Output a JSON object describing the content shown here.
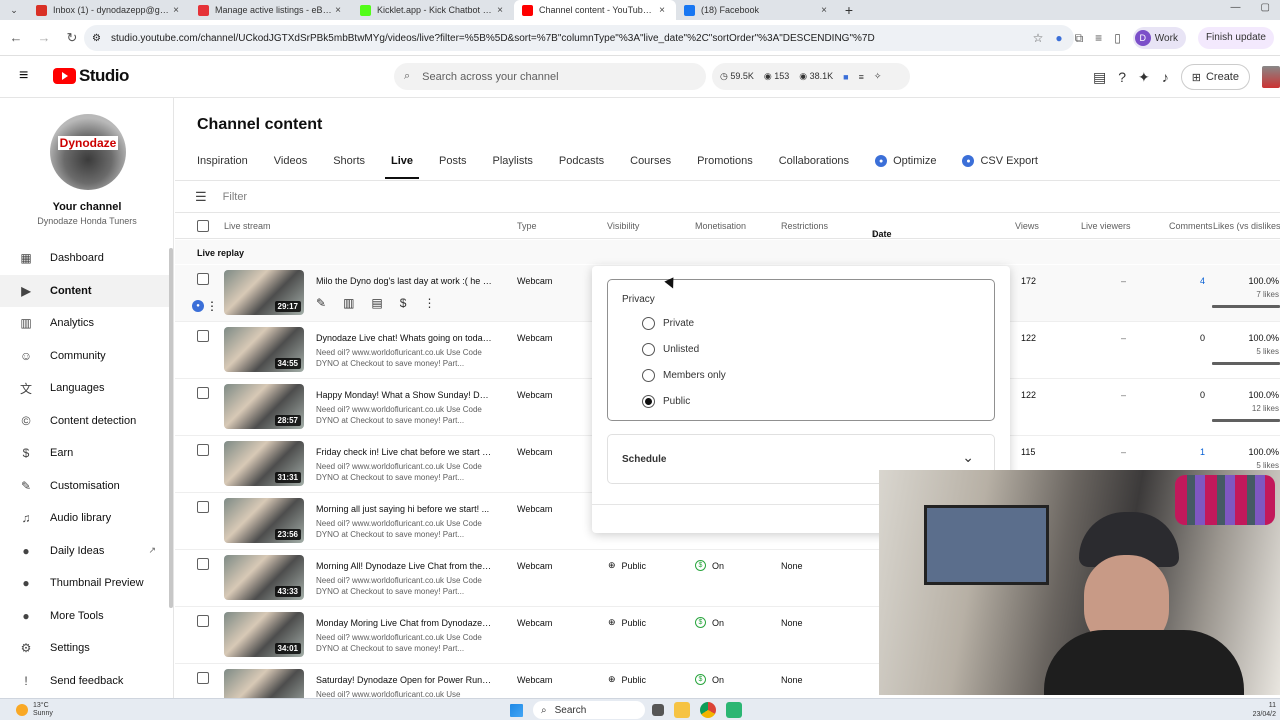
{
  "browser": {
    "tabs": [
      {
        "title": "Inbox (1) - dynodazepp@gmail.com",
        "color": "#d93025",
        "active": false
      },
      {
        "title": "Manage active listings - eBay Seller Hub",
        "color": "#e53238",
        "active": false
      },
      {
        "title": "Kicklet.app - Kick Chatbot and more",
        "color": "#53fc18",
        "active": false
      },
      {
        "title": "Channel content - YouTube Studio",
        "color": "#ff0000",
        "active": true
      },
      {
        "title": "(18) Facebook",
        "color": "#1877f2",
        "active": false
      }
    ],
    "url": "studio.youtube.com/channel/UCkodJGTXdSrPBk5mbBtwMYg/videos/live?filter=%5B%5D&sort=%7B\"columnType\"%3A\"live_date\"%2C\"sortOrder\"%3A\"DESCENDING\"%7D",
    "profile_label": "Work",
    "profile_initial": "D",
    "update_label": "Finish update"
  },
  "header": {
    "logo_text": "Studio",
    "search_placeholder": "Search across your channel",
    "stats": {
      "views": "59.5K",
      "watch": "153",
      "subs": "38.1K"
    },
    "create_label": "Create"
  },
  "sidebar": {
    "channel_label": "Your channel",
    "channel_name": "Dynodaze Honda Tuners",
    "avatar_text": "Dynodaze",
    "items": [
      {
        "label": "Dashboard",
        "icon": "dashboard-icon",
        "glyph": "▦"
      },
      {
        "label": "Content",
        "icon": "content-icon",
        "glyph": "▶",
        "active": true
      },
      {
        "label": "Analytics",
        "icon": "analytics-icon",
        "glyph": "▥"
      },
      {
        "label": "Community",
        "icon": "community-icon",
        "glyph": "☺"
      },
      {
        "label": "Languages",
        "icon": "languages-icon",
        "glyph": "文"
      },
      {
        "label": "Content detection",
        "icon": "copyright-icon",
        "glyph": "©"
      },
      {
        "label": "Earn",
        "icon": "earn-icon",
        "glyph": "$"
      },
      {
        "label": "Customisation",
        "icon": "customisation-icon",
        "glyph": "✎"
      },
      {
        "label": "Audio library",
        "icon": "audio-library-icon",
        "glyph": "♫"
      },
      {
        "label": "Daily Ideas",
        "icon": "daily-ideas-icon",
        "glyph": "●",
        "external": true
      },
      {
        "label": "Thumbnail Preview",
        "icon": "thumbnail-preview-icon",
        "glyph": "●"
      },
      {
        "label": "More Tools",
        "icon": "more-tools-icon",
        "glyph": "●"
      },
      {
        "label": "Settings",
        "icon": "settings-icon",
        "glyph": "⚙"
      },
      {
        "label": "Send feedback",
        "icon": "feedback-icon",
        "glyph": "!"
      }
    ]
  },
  "main": {
    "title": "Channel content",
    "tabs": [
      {
        "label": "Inspiration"
      },
      {
        "label": "Videos"
      },
      {
        "label": "Shorts"
      },
      {
        "label": "Live",
        "active": true
      },
      {
        "label": "Posts"
      },
      {
        "label": "Playlists"
      },
      {
        "label": "Podcasts"
      },
      {
        "label": "Courses"
      },
      {
        "label": "Promotions"
      },
      {
        "label": "Collaborations"
      },
      {
        "label": "Optimize",
        "badge": true
      },
      {
        "label": "CSV Export",
        "badge": true
      }
    ],
    "filter_placeholder": "Filter",
    "columns": {
      "live_stream": "Live stream",
      "type": "Type",
      "visibility": "Visibility",
      "monetisation": "Monetisation",
      "restrictions": "Restrictions",
      "date": "Date",
      "views": "Views",
      "live_viewers": "Live viewers",
      "comments": "Comments",
      "likes": "Likes (vs dislikes)"
    },
    "section_label": "Live replay",
    "rows": [
      {
        "title": "Milo the Dyno dog's last day at work :( he w...",
        "desc": "",
        "duration": "29:17",
        "type": "Webcam",
        "visibility": "",
        "monetisation": "",
        "restrictions": "",
        "views": "172",
        "live_viewers": "–",
        "comments": "4",
        "likes_pct": "100.0%",
        "likes": "7 likes"
      },
      {
        "title": "Dynodaze Live chat! Whats going on today...",
        "desc": "Need oil? www.worldofluricant.co.uk Use Code DYNO at Checkout to save money! Part...",
        "duration": "34:55",
        "type": "Webcam",
        "visibility": "",
        "monetisation": "",
        "restrictions": "",
        "views": "122",
        "live_viewers": "–",
        "comments": "0",
        "likes_pct": "100.0%",
        "likes": "5 likes"
      },
      {
        "title": "Happy Monday! What a Show Sunday! Dyn...",
        "desc": "Need oil? www.worldofluricant.co.uk Use Code DYNO at Checkout to save money! Part...",
        "duration": "28:57",
        "type": "Webcam",
        "visibility": "",
        "monetisation": "",
        "restrictions": "",
        "views": "122",
        "live_viewers": "–",
        "comments": "0",
        "likes_pct": "100.0%",
        "likes": "12 likes"
      },
      {
        "title": "Friday check in! Live chat before we start D...",
        "desc": "Need oil? www.worldofluricant.co.uk Use Code DYNO at Checkout to save money! Part...",
        "duration": "31:31",
        "type": "Webcam",
        "visibility": "",
        "monetisation": "",
        "restrictions": "",
        "views": "115",
        "live_viewers": "–",
        "comments": "1",
        "likes_pct": "100.0%",
        "likes": "5 likes"
      },
      {
        "title": "Morning all just saying hi before we start! ...",
        "desc": "Need oil? www.worldofluricant.co.uk Use Code DYNO at Checkout to save money! Part...",
        "duration": "23:56",
        "type": "Webcam",
        "visibility": "",
        "monetisation": "",
        "restrictions": "",
        "views": "",
        "live_viewers": "",
        "comments": "",
        "likes_pct": "",
        "likes": ""
      },
      {
        "title": "Morning All! Dynodaze Live Chat from the ...",
        "desc": "Need oil? www.worldofluricant.co.uk Use Code DYNO at Checkout to save money! Part...",
        "duration": "43:33",
        "type": "Webcam",
        "visibility": "Public",
        "monetisation": "On",
        "restrictions": "None",
        "views": "",
        "live_viewers": "",
        "comments": "",
        "likes_pct": "",
        "likes": ""
      },
      {
        "title": "Monday Moring Live Chat from Dynodaze ...",
        "desc": "Need oil? www.worldofluricant.co.uk Use Code DYNO at Checkout to save money! Part...",
        "duration": "34:01",
        "type": "Webcam",
        "visibility": "Public",
        "monetisation": "On",
        "restrictions": "None",
        "views": "",
        "live_viewers": "",
        "comments": "",
        "likes_pct": "",
        "likes": ""
      },
      {
        "title": "Saturday! Dynodaze Open for Power Runs! ...",
        "desc": "Need oil? www.worldofluricant.co.uk Use",
        "duration": "",
        "type": "Webcam",
        "visibility": "Public",
        "monetisation": "On",
        "restrictions": "None",
        "views": "",
        "live_viewers": "",
        "comments": "",
        "likes_pct": "",
        "likes": ""
      }
    ]
  },
  "privacy_popover": {
    "label": "Privacy",
    "options": [
      {
        "label": "Private",
        "selected": false
      },
      {
        "label": "Unlisted",
        "selected": false
      },
      {
        "label": "Members only",
        "selected": false
      },
      {
        "label": "Public",
        "selected": true
      }
    ],
    "schedule_label": "Schedule"
  },
  "taskbar": {
    "temp": "13°C",
    "weather": "Sunny",
    "search_label": "Search",
    "time": "11",
    "date": "23/04/2"
  }
}
